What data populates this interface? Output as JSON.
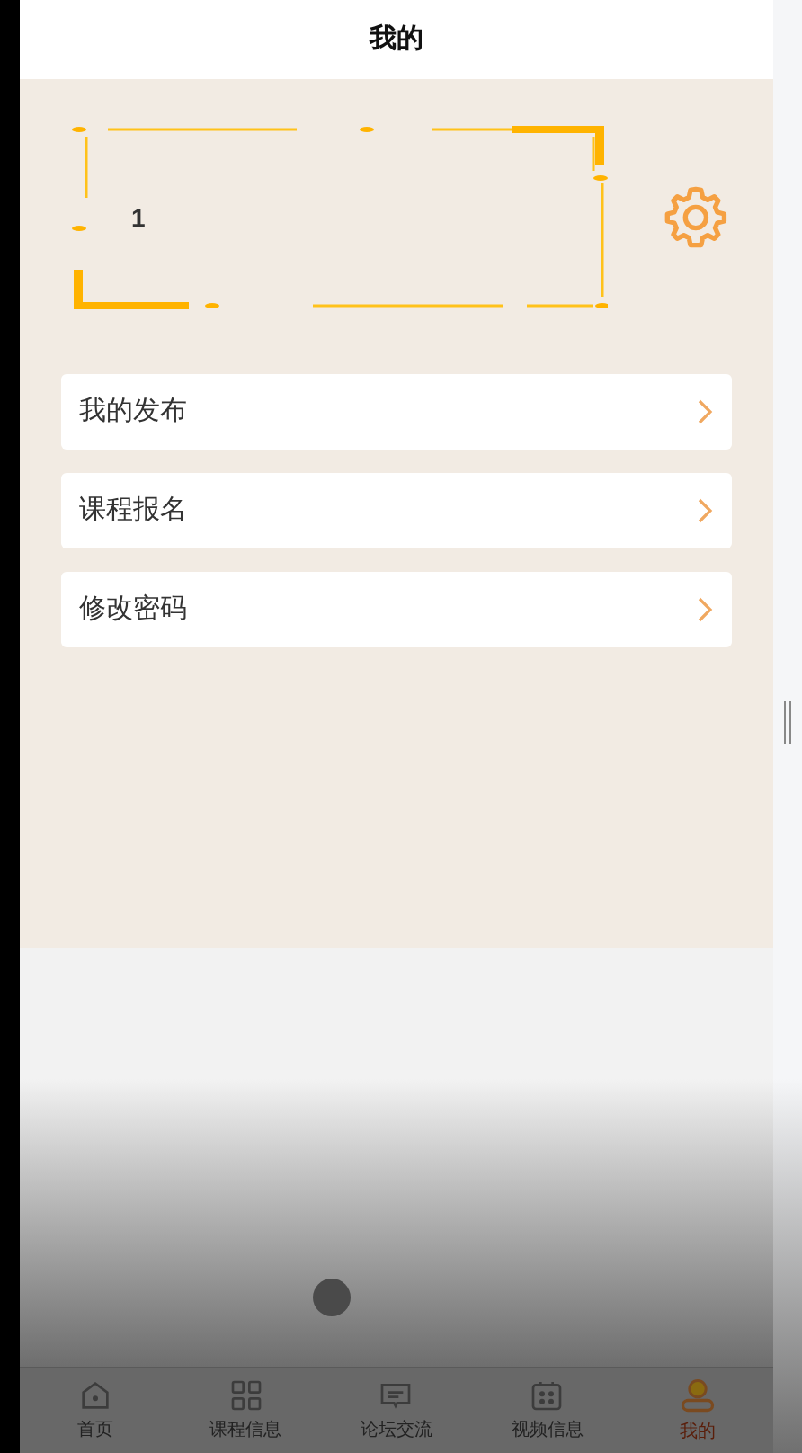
{
  "header": {
    "title": "我的"
  },
  "profile": {
    "username": "1"
  },
  "menu": [
    {
      "label": "我的发布"
    },
    {
      "label": "课程报名"
    },
    {
      "label": "修改密码"
    }
  ],
  "tabbar": [
    {
      "label": "首页",
      "kind": "home",
      "selected": false
    },
    {
      "label": "课程信息",
      "kind": "grid",
      "selected": false
    },
    {
      "label": "论坛交流",
      "kind": "chat",
      "selected": false
    },
    {
      "label": "视频信息",
      "kind": "calendar",
      "selected": false
    },
    {
      "label": "我的",
      "kind": "user",
      "selected": true
    }
  ]
}
